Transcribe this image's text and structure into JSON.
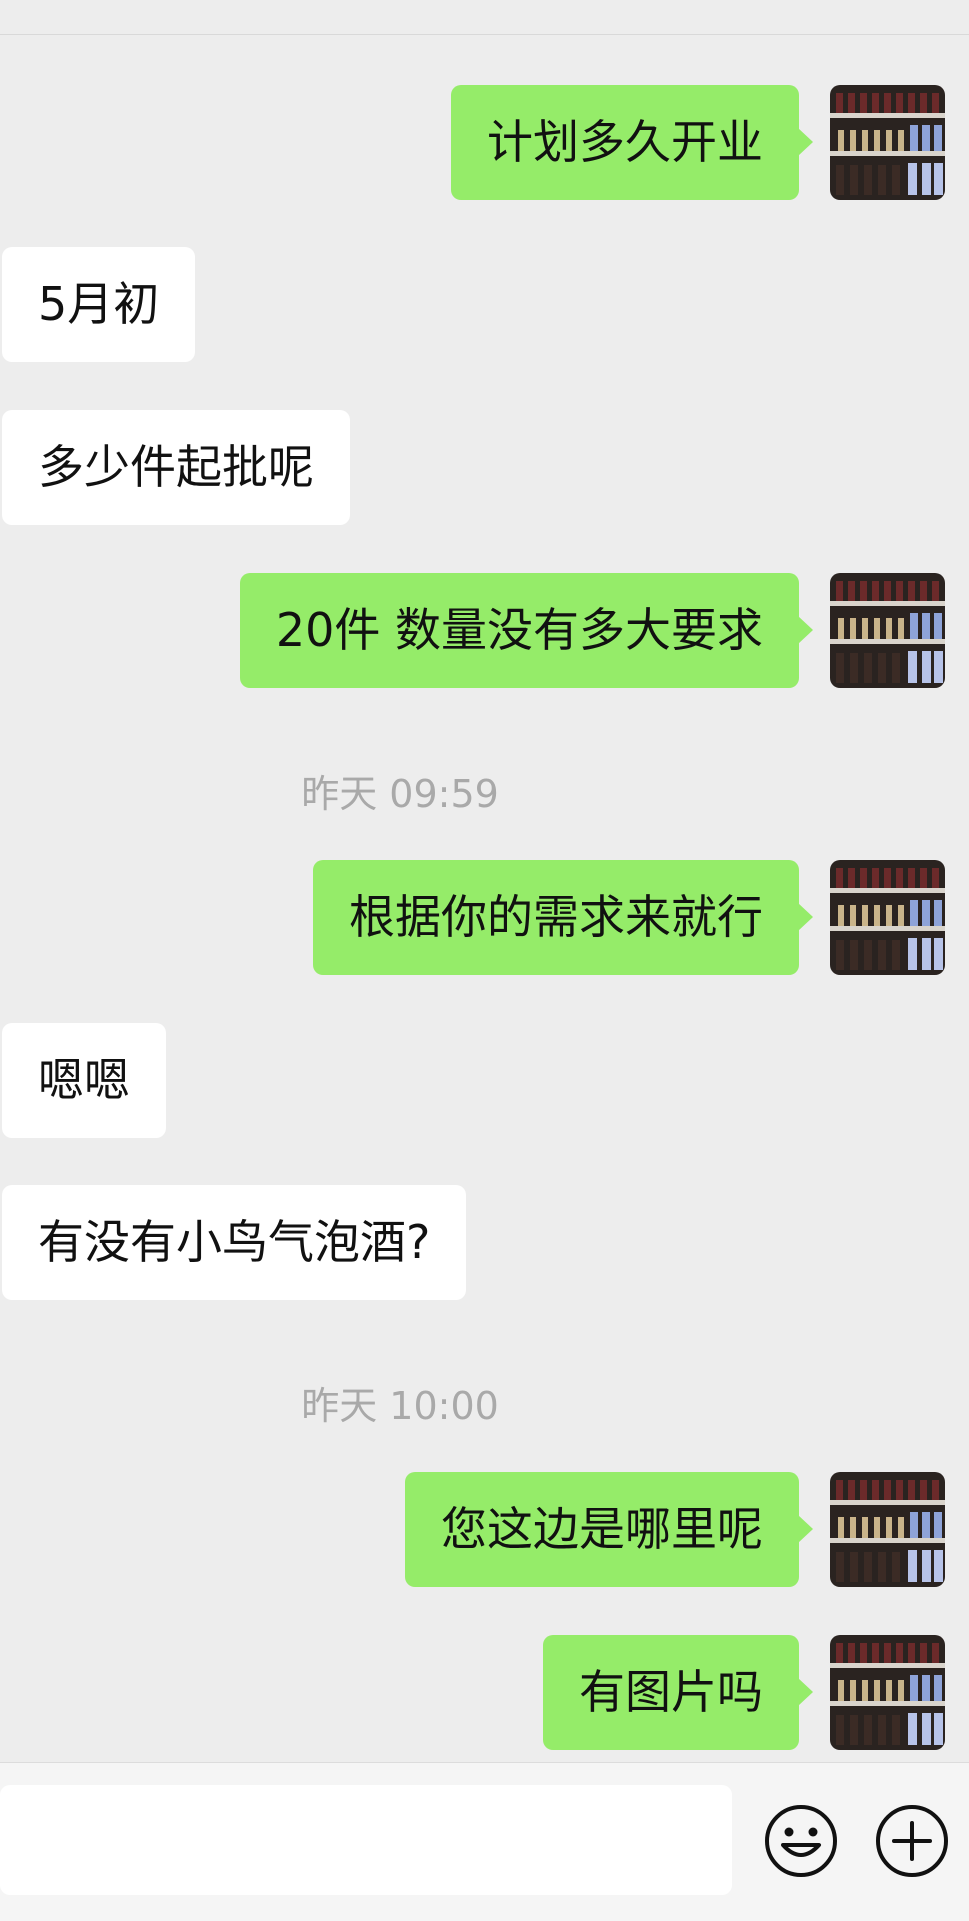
{
  "messages": [
    {
      "side": "right",
      "text": "计划多久开业"
    },
    {
      "side": "left",
      "text": "5月初"
    },
    {
      "side": "left",
      "text": "多少件起批呢"
    },
    {
      "side": "right",
      "text": "20件 数量没有多大要求"
    },
    {
      "type": "time",
      "text": "昨天 09:59"
    },
    {
      "side": "right",
      "text": "根据你的需求来就行"
    },
    {
      "side": "left",
      "text": "嗯嗯"
    },
    {
      "side": "left",
      "text": "有没有小鸟气泡酒?"
    },
    {
      "type": "time",
      "text": "昨天 10:00"
    },
    {
      "side": "right",
      "text": "您这边是哪里呢"
    },
    {
      "side": "right",
      "text": "有图片吗"
    }
  ],
  "input": {
    "value": "",
    "placeholder": ""
  },
  "icons": {
    "emoji": "emoji-face-icon",
    "more": "plus-circle-icon"
  },
  "colors": {
    "sent_bubble": "#95ec69",
    "received_bubble": "#ffffff",
    "background": "#ededed",
    "timestamp": "#a9a9a9"
  }
}
